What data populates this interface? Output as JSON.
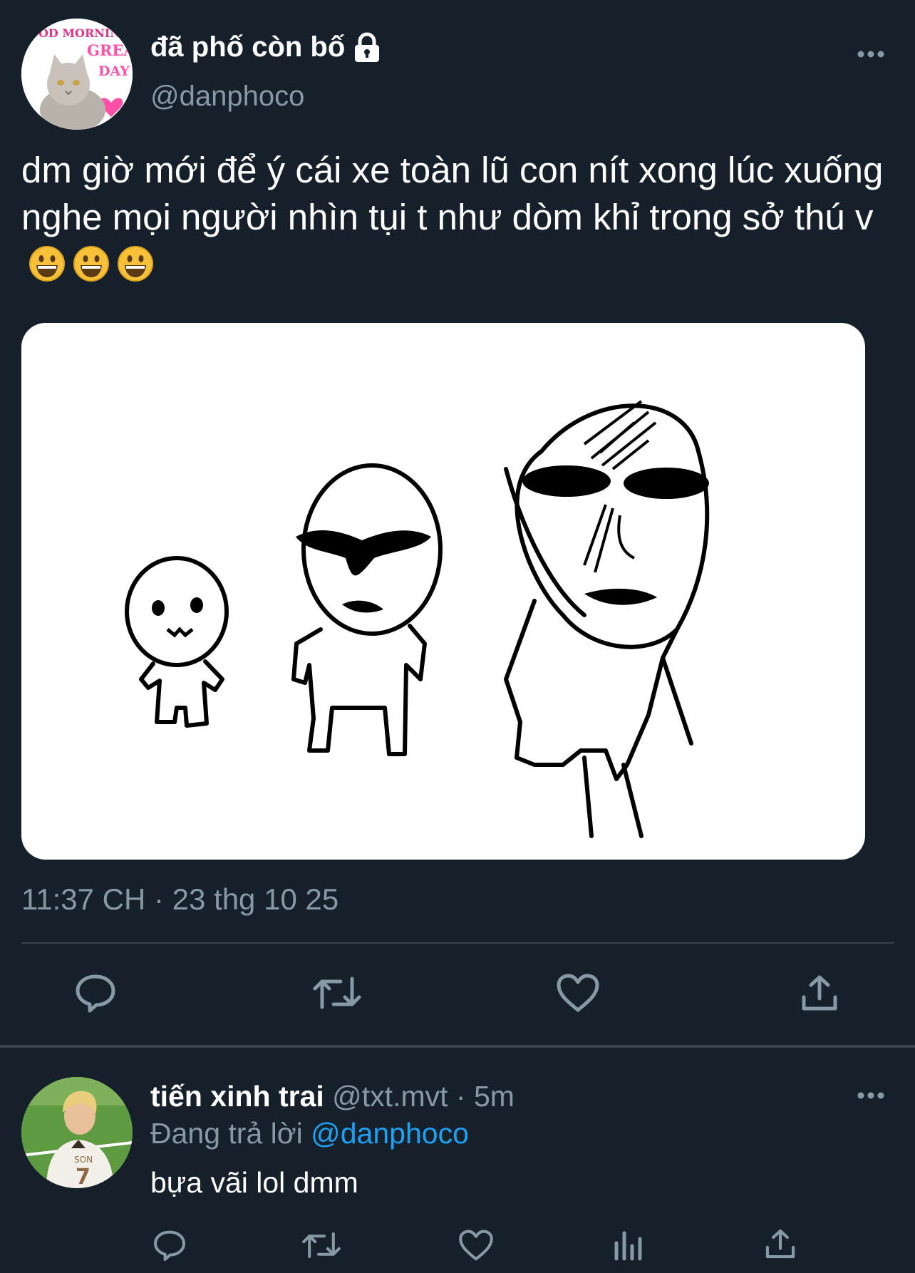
{
  "tweet": {
    "author": {
      "display_name": "đã phố còn bố",
      "handle": "@danphoco",
      "avatar_icon": "cat-avatar",
      "avatar_text_1": "OOD MORNING",
      "avatar_text_2": "GREAT",
      "avatar_text_3": "DAY",
      "protected_icon": "lock-icon"
    },
    "text": "dm giờ mới để ý cái xe toàn lũ con nít xong lúc xuống nghe mọi người nhìn tụi t như dòm khỉ trong sở thú v",
    "emojis": [
      "grinning-face-icon",
      "grinning-face-icon",
      "grinning-face-icon"
    ],
    "media": {
      "icon": "stick-figure-drawing-image"
    },
    "timestamp": "11:37 CH · 23 thg 10 25",
    "actions": [
      "reply-icon",
      "retweet-icon",
      "like-icon",
      "share-icon"
    ]
  },
  "reply": {
    "display_name": "tiến xinh trai",
    "handle": "@txt.mvt",
    "separator": " · ",
    "time": "5m",
    "replying_to_label": "Đang trả lời ",
    "replying_to_handle": "@danphoco",
    "text": "bựa vãi lol dmm",
    "avatar_jersey_name": "SON",
    "avatar_jersey_number": "7",
    "actions": [
      "reply-icon",
      "retweet-icon",
      "like-icon",
      "analytics-icon",
      "share-icon"
    ]
  },
  "colors": {
    "background": "#15202b",
    "secondary_text": "#8899a6",
    "divider": "#38444d",
    "link": "#1da1f2"
  }
}
